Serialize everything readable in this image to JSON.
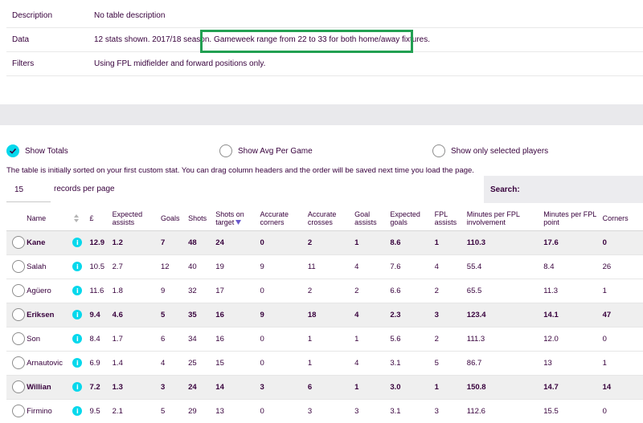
{
  "info": {
    "description_label": "Description",
    "description_value": "No table description",
    "data_label": "Data",
    "data_value": "12 stats shown. 2017/18 season. Gameweek range from 22 to 33 for both home/away fixtures.",
    "filters_label": "Filters",
    "filters_value": "Using FPL midfielder and forward positions only."
  },
  "options": {
    "show_totals": "Show Totals",
    "show_avg": "Show Avg Per Game",
    "show_selected": "Show only selected players",
    "selected": "show_totals"
  },
  "hint": "The table is initially sorted on your first custom stat. You can drag column headers and the order will be saved next time you load the page.",
  "records": {
    "value": "15",
    "label": "records per page"
  },
  "search": {
    "label": "Search:"
  },
  "colors": {
    "accent": "#05d8ec",
    "text": "#37003c",
    "highlight": "#22a052"
  },
  "table": {
    "headers": [
      "Name",
      "£",
      "Expected assists",
      "Goals",
      "Shots",
      "Shots on target",
      "Accurate corners",
      "Accurate crosses",
      "Goal assists",
      "Expected goals",
      "FPL assists",
      "Minutes per FPL involvement",
      "Minutes per FPL point",
      "Corners"
    ],
    "sorted_column": "Shots on target",
    "rows": [
      {
        "bold": true,
        "cells": [
          "Kane",
          "12.9",
          "1.2",
          "7",
          "48",
          "24",
          "0",
          "2",
          "1",
          "8.6",
          "1",
          "110.3",
          "17.6",
          "0"
        ]
      },
      {
        "bold": false,
        "cells": [
          "Salah",
          "10.5",
          "2.7",
          "12",
          "40",
          "19",
          "9",
          "11",
          "4",
          "7.6",
          "4",
          "55.4",
          "8.4",
          "26"
        ]
      },
      {
        "bold": false,
        "cells": [
          "Agüero",
          "11.6",
          "1.8",
          "9",
          "32",
          "17",
          "0",
          "2",
          "2",
          "6.6",
          "2",
          "65.5",
          "11.3",
          "1"
        ]
      },
      {
        "bold": true,
        "cells": [
          "Eriksen",
          "9.4",
          "4.6",
          "5",
          "35",
          "16",
          "9",
          "18",
          "4",
          "2.3",
          "3",
          "123.4",
          "14.1",
          "47"
        ]
      },
      {
        "bold": false,
        "cells": [
          "Son",
          "8.4",
          "1.7",
          "6",
          "34",
          "16",
          "0",
          "1",
          "1",
          "5.6",
          "2",
          "111.3",
          "12.0",
          "0"
        ]
      },
      {
        "bold": false,
        "cells": [
          "Arnautovic",
          "6.9",
          "1.4",
          "4",
          "25",
          "15",
          "0",
          "1",
          "4",
          "3.1",
          "5",
          "86.7",
          "13",
          "1"
        ]
      },
      {
        "bold": true,
        "cells": [
          "Willian",
          "7.2",
          "1.3",
          "3",
          "24",
          "14",
          "3",
          "6",
          "1",
          "3.0",
          "1",
          "150.8",
          "14.7",
          "14"
        ]
      },
      {
        "bold": false,
        "cells": [
          "Firmino",
          "9.5",
          "2.1",
          "5",
          "29",
          "13",
          "0",
          "3",
          "3",
          "3.1",
          "3",
          "112.6",
          "15.5",
          "0"
        ]
      }
    ]
  }
}
